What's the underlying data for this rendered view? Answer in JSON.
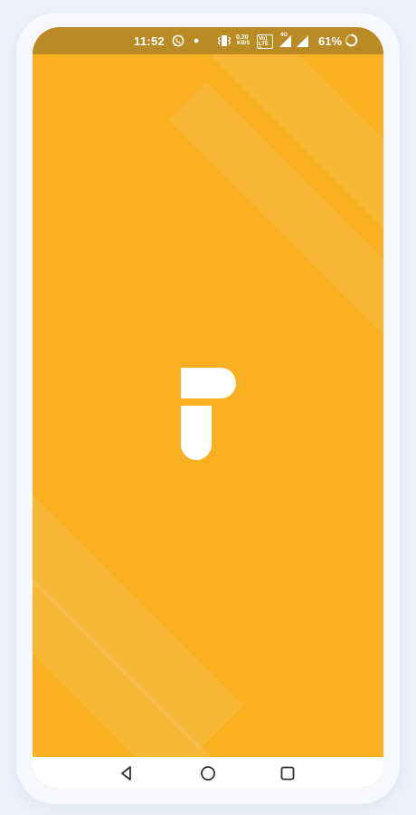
{
  "status_bar": {
    "time": "11:52",
    "network_speed_value": "0.20",
    "network_speed_unit": "KB/S",
    "volte_label": "Vo) LTE 2",
    "network_type": "4G",
    "battery_percent": "61%",
    "icons": [
      "whatsapp-icon",
      "dot-icon",
      "vibrate-icon",
      "signal-icon",
      "signal-icon",
      "battery-ring-icon"
    ]
  },
  "splash": {
    "background_color": "#f8b020",
    "logo_color": "#ffffff",
    "logo_icon": "app-logo-icon"
  },
  "navigation_bar": {
    "buttons": [
      "back-icon",
      "home-icon",
      "recents-icon"
    ]
  }
}
